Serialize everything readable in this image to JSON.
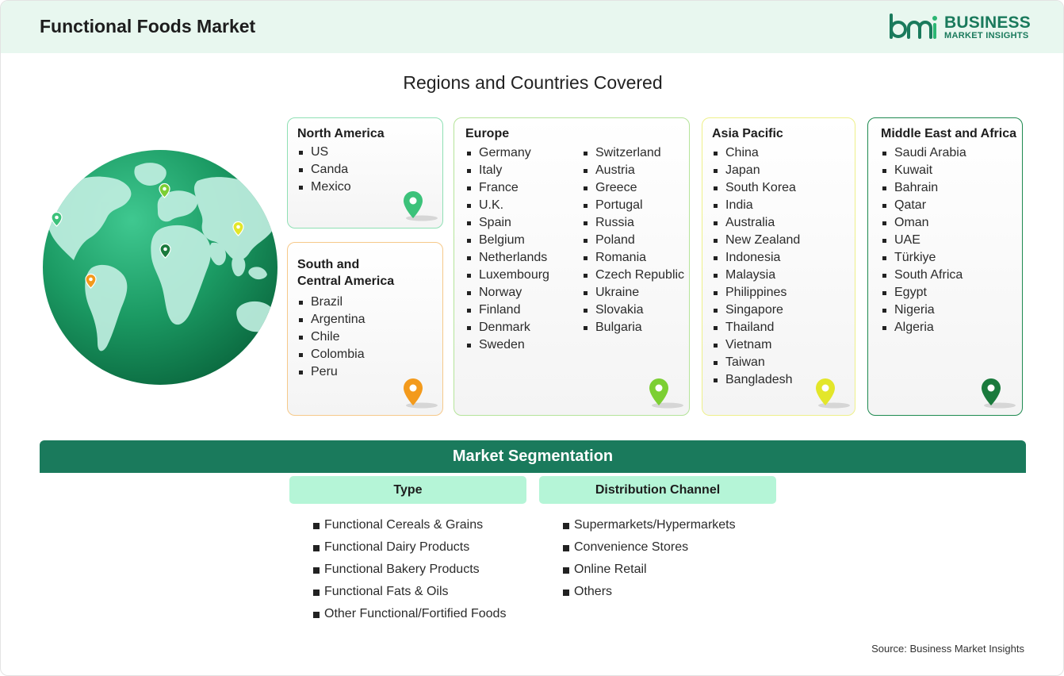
{
  "header": {
    "title": "Functional Foods Market",
    "logo": {
      "abbr": "bmi",
      "line1": "BUSINESS",
      "line2": "MARKET INSIGHTS"
    }
  },
  "section_title": "Regions and Countries Covered",
  "regions": {
    "north_america": {
      "title": "North America",
      "countries": [
        "US",
        "Canda",
        "Mexico"
      ],
      "pin_color": "#3cc27a"
    },
    "south_central_america": {
      "title_line1": "South and",
      "title_line2": "Central America",
      "countries": [
        "Brazil",
        "Argentina",
        "Chile",
        "Colombia",
        "Peru"
      ],
      "pin_color": "#f39a1c"
    },
    "europe": {
      "title": "Europe",
      "countries_col1": [
        "Germany",
        "Italy",
        "France",
        "U.K.",
        "Spain",
        "Belgium",
        "Netherlands",
        "Luxembourg",
        "Norway",
        "Finland",
        "Denmark",
        "Sweden"
      ],
      "countries_col2": [
        "Switzerland",
        "Austria",
        "Greece",
        "Portugal",
        "Russia",
        "Poland",
        "Romania",
        "Czech Republic",
        "Ukraine",
        "Slovakia",
        "Bulgaria"
      ],
      "pin_color": "#7ccf33"
    },
    "asia_pacific": {
      "title": "Asia Pacific",
      "countries": [
        "China",
        "Japan",
        "South Korea",
        "India",
        "Australia",
        "New Zealand",
        "Indonesia",
        "Malaysia",
        "Philippines",
        "Singapore",
        "Thailand",
        "Vietnam",
        "Taiwan",
        "Bangladesh"
      ],
      "pin_color": "#e3e62a"
    },
    "middle_east_africa": {
      "title": "Middle East and Africa",
      "countries": [
        "Saudi Arabia",
        "Kuwait",
        "Bahrain",
        "Qatar",
        "Oman",
        "UAE",
        "Türkiye",
        "South Africa",
        "Egypt",
        "Nigeria",
        "Algeria"
      ],
      "pin_color": "#1a7a3c"
    }
  },
  "segmentation": {
    "title": "Market Segmentation",
    "type": {
      "header": "Type",
      "items": [
        "Functional Cereals & Grains",
        "Functional Dairy Products",
        "Functional Bakery Products",
        "Functional Fats & Oils",
        "Other Functional/Fortified Foods"
      ]
    },
    "distribution_channel": {
      "header": "Distribution Channel",
      "items": [
        "Supermarkets/Hypermarkets",
        "Convenience Stores",
        "Online Retail",
        "Others"
      ]
    }
  },
  "source": "Source: Business Market Insights",
  "colors": {
    "brand_green": "#1a7a5c",
    "header_bg": "#e8f7ef",
    "segment_header_bg": "#b5f5d7"
  }
}
